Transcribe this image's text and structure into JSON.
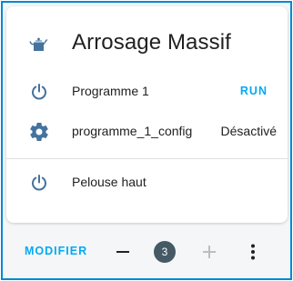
{
  "card": {
    "title": "Arrosage Massif",
    "header_icon": "watering-can-icon"
  },
  "rows": [
    {
      "icon": "power-icon",
      "label": "Programme 1",
      "action": "RUN"
    },
    {
      "icon": "gear-icon",
      "label": "programme_1_config",
      "state": "Désactivé"
    },
    {
      "icon": "power-icon",
      "label": "Pelouse haut"
    }
  ],
  "footer": {
    "edit_label": "MODIFIER",
    "minus_icon": "minus-icon",
    "count": "3",
    "plus_icon": "plus-icon",
    "more_icon": "more-vertical-icon"
  },
  "colors": {
    "accent": "#03a9f4",
    "frame_border": "#0288d1",
    "icon": "#44739e",
    "badge": "#455a64",
    "disabled": "#bdbdbd"
  }
}
